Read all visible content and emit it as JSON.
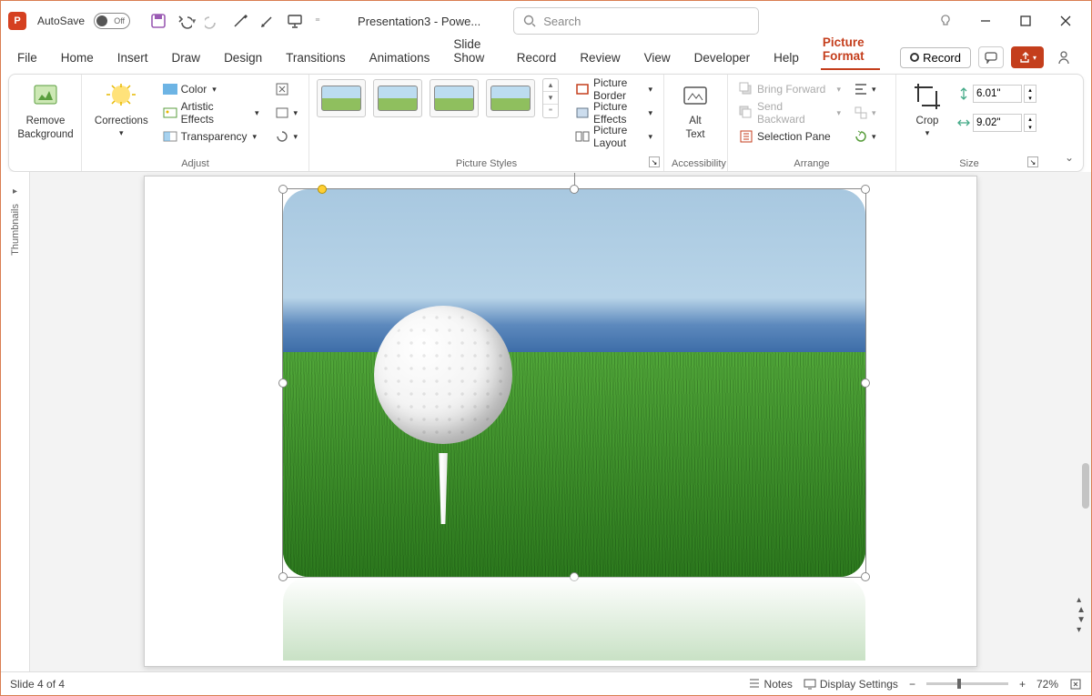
{
  "autosave_label": "AutoSave",
  "autosave_state": "Off",
  "doc_title": "Presentation3 - Powe...",
  "search_placeholder": "Search",
  "tabs": [
    "File",
    "Home",
    "Insert",
    "Draw",
    "Design",
    "Transitions",
    "Animations",
    "Slide Show",
    "Record",
    "Review",
    "View",
    "Developer",
    "Help",
    "Picture Format"
  ],
  "active_tab": "Picture Format",
  "record_label": "Record",
  "ribbon": {
    "adjust": {
      "remove_bg": "Remove\nBackground",
      "corrections": "Corrections",
      "color": "Color",
      "artistic": "Artistic Effects",
      "transparency": "Transparency",
      "group_label": "Adjust"
    },
    "styles": {
      "border": "Picture Border",
      "effects": "Picture Effects",
      "layout": "Picture Layout",
      "group_label": "Picture Styles"
    },
    "accessibility": {
      "alt_text": "Alt\nText",
      "group_label": "Accessibility"
    },
    "arrange": {
      "forward": "Bring Forward",
      "backward": "Send Backward",
      "pane": "Selection Pane",
      "group_label": "Arrange"
    },
    "size": {
      "crop": "Crop",
      "height": "6.01\"",
      "width": "9.02\"",
      "group_label": "Size"
    }
  },
  "thumbnails_label": "Thumbnails",
  "status": {
    "slide": "Slide 4 of 4",
    "notes": "Notes",
    "display": "Display Settings",
    "zoom": "72%"
  }
}
